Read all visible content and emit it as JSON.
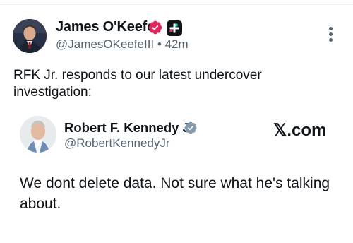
{
  "tweet": {
    "author_name": "James O'Keefe",
    "handle": "@JamesOKeefeIII",
    "time": "42m",
    "separator": "•",
    "text": "RFK Jr. responds to our latest undercover investigation:"
  },
  "quoted": {
    "author_name": "Robert F. Kennedy Jr",
    "handle": "@RobertKennedyJr",
    "source": "𝕏.com",
    "text": "We dont delete data. Not sure what he's talking about."
  },
  "colors": {
    "text_primary": "#0f1419",
    "text_secondary": "#536471",
    "verified_pink": "#e0245e",
    "verified_gray": "#829aab"
  }
}
